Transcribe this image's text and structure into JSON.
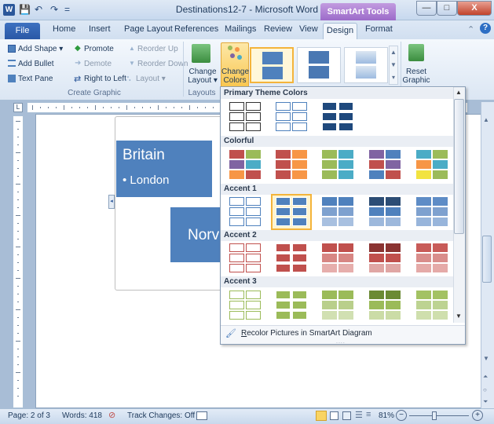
{
  "window": {
    "title": "Destinations12-7 - Microsoft Word",
    "contextual_tab": "SmartArt Tools",
    "minimize": "—",
    "maximize": "□",
    "close": "X"
  },
  "qat": {
    "app_icon": "W",
    "save": "💾",
    "undo": "↶",
    "redo": "↷",
    "customize": "="
  },
  "tabs": {
    "file": "File",
    "home": "Home",
    "insert": "Insert",
    "page_layout": "Page Layout",
    "references": "References",
    "mailings": "Mailings",
    "review": "Review",
    "view": "View",
    "design": "Design",
    "format": "Format"
  },
  "ribbon": {
    "add_shape": "Add Shape ▾",
    "add_bullet": "Add Bullet",
    "text_pane": "Text Pane",
    "promote": "Promote",
    "demote": "Demote",
    "right_to_left": "Right to Left",
    "reorder_up": "Reorder Up",
    "reorder_down": "Reorder Down",
    "layout": "Layout ▾",
    "group_create_graphic": "Create Graphic",
    "change_layout": "Change Layout ▾",
    "group_layouts": "Layouts",
    "change_colors": "Change Colors ▾",
    "reset_graphic": "Reset Graphic"
  },
  "document": {
    "britain": "Britain",
    "london": "• London",
    "norway": "Norv"
  },
  "dropdown": {
    "sections": [
      {
        "title": "Primary Theme Colors"
      },
      {
        "title": "Colorful"
      },
      {
        "title": "Accent 1"
      },
      {
        "title": "Accent 2"
      },
      {
        "title": "Accent 3"
      }
    ],
    "recolor": "Recolor Pictures in SmartArt Diagram",
    "recolor_hotkey": "R",
    "recolor_rest": "ecolor Pictures in SmartArt Diagram"
  },
  "status": {
    "page": "Page: 2 of 3",
    "words": "Words: 418",
    "track_changes": "Track Changes: Off",
    "zoom": "81%",
    "zoom_minus": "−",
    "zoom_plus": "+"
  },
  "colors": {
    "accent": "#4f81bd",
    "accent2": "#c0504d",
    "accent3": "#9bbb59",
    "dark": "#1f497d",
    "highlight": "#f4b43b"
  }
}
